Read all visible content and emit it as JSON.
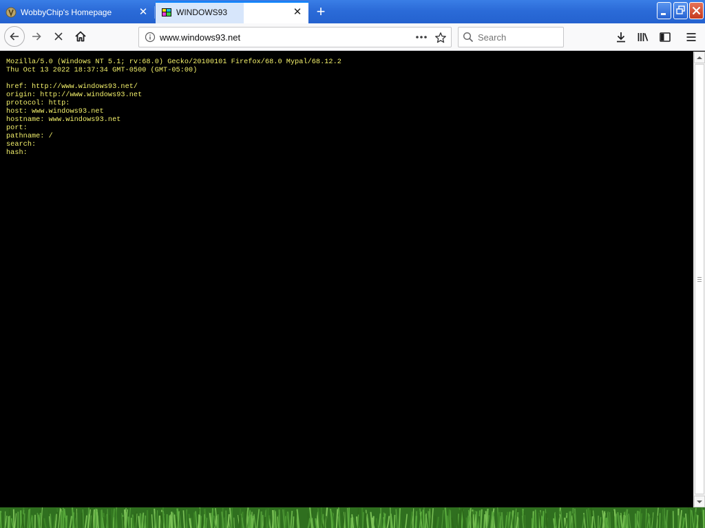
{
  "tabs": [
    {
      "title": "WobbyChip's Homepage",
      "active": false,
      "favicon": "rune-icon"
    },
    {
      "title": "WINDOWS93",
      "active": true,
      "favicon": "windows93-icon"
    }
  ],
  "toolbar": {
    "back_icon": "arrow-left-icon",
    "forward_icon": "arrow-right-icon",
    "stop_icon": "stop-icon",
    "home_icon": "home-icon"
  },
  "urlbar": {
    "url": "www.windows93.net"
  },
  "search": {
    "placeholder": "Search"
  },
  "page": {
    "user_agent": "Mozilla/5.0 (Windows NT 5.1; rv:68.0) Gecko/20100101 Firefox/68.0 Mypal/68.12.2",
    "date": "Thu Oct 13 2022 18:37:34 GMT-0500 (GMT-05:00)",
    "location": [
      "href: http://www.windows93.net/",
      "origin: http://www.windows93.net",
      "protocol: http:",
      "host: www.windows93.net",
      "hostname: www.windows93.net",
      "port:",
      "pathname: /",
      "search:",
      "hash:"
    ]
  },
  "colors": {
    "titlebar": "#2b6bd8",
    "page_background": "#000000",
    "page_text": "#f5f26c",
    "accent": "#0a84ff"
  }
}
